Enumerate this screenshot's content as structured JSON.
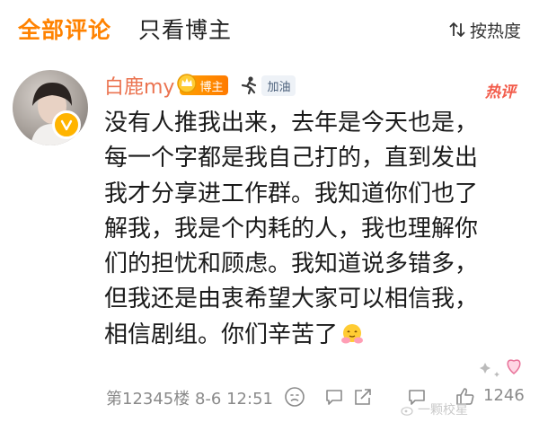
{
  "header": {
    "tab_all": "全部评论",
    "tab_blogger": "只看博主",
    "sort_label": "按热度"
  },
  "comment": {
    "username": "白鹿my",
    "blogger_badge": "博主",
    "cheer_label": "加油",
    "hot_tag": "热评",
    "lines": [
      "没有人推我出来，去年是今天也是，",
      "每一个字都是我自己打的，直到发出",
      "我才分享进工作群。我知道你们也了",
      "解我，我是个内耗的人，我也理解你",
      "们的担忧和顾虑。我知道说多错多，",
      "但我还是由衷希望大家可以相信我，",
      "相信剧组。你们辛苦了"
    ],
    "emoji_icon": "hug-emoji",
    "meta": "第12345楼 8-6 12:51",
    "like_count": "1246"
  },
  "watermark": "一颗校星",
  "colors": {
    "accent": "#ff8200",
    "username": "#eb7350",
    "hot": "#f25b4a",
    "muted": "#8a8a8a"
  }
}
